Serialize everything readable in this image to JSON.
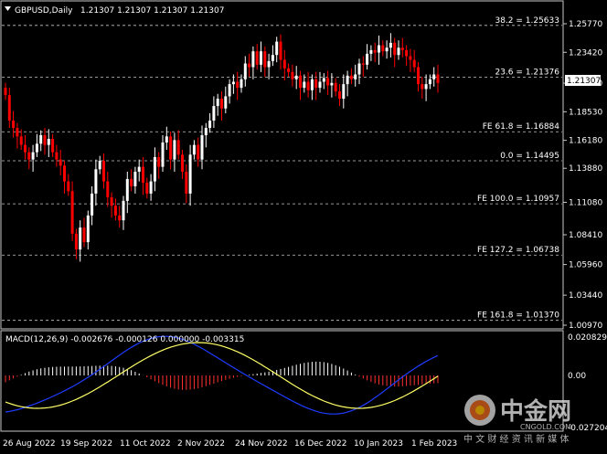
{
  "header": {
    "symbol": "GBPUSD,Daily",
    "ohlc": "1.21307 1.21307 1.21307 1.21307"
  },
  "price_axis": {
    "ticks": [
      "1.25770",
      "1.23420",
      "1.20880",
      "1.18530",
      "1.16180",
      "1.13880",
      "1.11080",
      "1.08410",
      "1.05960",
      "1.03440",
      "1.00970"
    ],
    "current_price": "1.21307"
  },
  "fib_levels": [
    {
      "label": "38.2 = 1.25633",
      "price": 1.25633
    },
    {
      "label": "23.6 = 1.21376",
      "price": 1.21376
    },
    {
      "label": "FE 61.8 = 1.16884",
      "price": 1.16884
    },
    {
      "label": "0.0 = 1.14495",
      "price": 1.14495
    },
    {
      "label": "FE 100.0 = 1.10957",
      "price": 1.10957
    },
    {
      "label": "FE 127.2 = 1.06738",
      "price": 1.06738
    },
    {
      "label": "FE 161.8 = 1.01370",
      "price": 1.0137
    }
  ],
  "macd": {
    "label": "MACD(12,26,9) -0.002676 -0.000126 0.000000 -0.003315",
    "ticks": [
      "0.020829",
      "0.00",
      "-0.027204"
    ]
  },
  "date_axis": [
    "26 Aug 2022",
    "19 Sep 2022",
    "11 Oct 2022",
    "2 Nov 2022",
    "24 Nov 2022",
    "16 Dec 2022",
    "10 Jan 2023",
    "1 Feb 2023"
  ],
  "colors": {
    "bull": "#ffffff",
    "bear": "#ff0000",
    "grid": "#c8c8c8",
    "macd_line": "#1e3cff",
    "signal_line": "#ffff66"
  },
  "watermark": {
    "brand": "中金网",
    "site": "CNGOLD.COM",
    "tagline": "中 文 财 经 资 讯 新 媒 体"
  },
  "chart_data": {
    "type": "candlestick",
    "ylim": [
      1.0097,
      1.2577
    ],
    "closes": [
      1.199,
      1.178,
      1.172,
      1.165,
      1.158,
      1.152,
      1.146,
      1.152,
      1.159,
      1.166,
      1.158,
      1.163,
      1.152,
      1.146,
      1.141,
      1.128,
      1.12,
      1.085,
      1.072,
      1.09,
      1.078,
      1.1,
      1.118,
      1.138,
      1.145,
      1.128,
      1.115,
      1.108,
      1.1,
      1.096,
      1.112,
      1.13,
      1.124,
      1.136,
      1.14,
      1.127,
      1.118,
      1.128,
      1.148,
      1.14,
      1.16,
      1.165,
      1.146,
      1.162,
      1.15,
      1.136,
      1.118,
      1.15,
      1.158,
      1.146,
      1.166,
      1.172,
      1.178,
      1.19,
      1.196,
      1.188,
      1.198,
      1.208,
      1.21,
      1.205,
      1.212,
      1.225,
      1.222,
      1.235,
      1.224,
      1.235,
      1.222,
      1.227,
      1.232,
      1.243,
      1.228,
      1.221,
      1.218,
      1.212,
      1.215,
      1.205,
      1.21,
      1.203,
      1.212,
      1.205,
      1.21,
      1.213,
      1.207,
      1.209,
      1.202,
      1.196,
      1.208,
      1.215,
      1.212,
      1.216,
      1.225,
      1.224,
      1.233,
      1.236,
      1.234,
      1.24,
      1.235,
      1.238,
      1.242,
      1.232,
      1.238,
      1.236,
      1.231,
      1.228,
      1.222,
      1.208,
      1.204,
      1.208,
      1.212,
      1.216,
      1.209
    ],
    "opens": [
      1.205,
      1.199,
      1.178,
      1.172,
      1.165,
      1.158,
      1.152,
      1.146,
      1.152,
      1.159,
      1.166,
      1.158,
      1.163,
      1.152,
      1.146,
      1.141,
      1.128,
      1.12,
      1.085,
      1.072,
      1.09,
      1.078,
      1.1,
      1.118,
      1.138,
      1.145,
      1.128,
      1.115,
      1.108,
      1.1,
      1.096,
      1.112,
      1.13,
      1.124,
      1.136,
      1.14,
      1.127,
      1.118,
      1.128,
      1.148,
      1.14,
      1.16,
      1.165,
      1.146,
      1.162,
      1.15,
      1.136,
      1.118,
      1.15,
      1.158,
      1.146,
      1.166,
      1.172,
      1.178,
      1.19,
      1.196,
      1.188,
      1.198,
      1.208,
      1.21,
      1.205,
      1.212,
      1.225,
      1.222,
      1.235,
      1.224,
      1.235,
      1.222,
      1.227,
      1.232,
      1.243,
      1.228,
      1.221,
      1.218,
      1.212,
      1.215,
      1.205,
      1.21,
      1.203,
      1.212,
      1.205,
      1.21,
      1.213,
      1.207,
      1.209,
      1.202,
      1.196,
      1.208,
      1.215,
      1.212,
      1.216,
      1.225,
      1.224,
      1.233,
      1.236,
      1.234,
      1.24,
      1.235,
      1.238,
      1.242,
      1.232,
      1.238,
      1.236,
      1.231,
      1.228,
      1.222,
      1.208,
      1.204,
      1.208,
      1.212,
      1.216
    ]
  }
}
